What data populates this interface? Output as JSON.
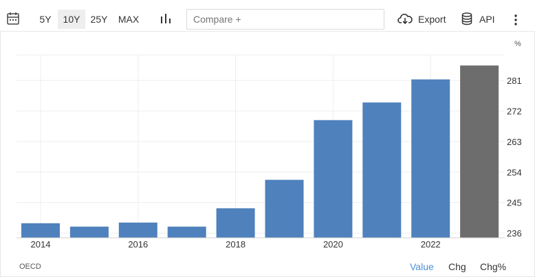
{
  "toolbar": {
    "ranges": [
      "5Y",
      "10Y",
      "25Y",
      "MAX"
    ],
    "active_range": "10Y",
    "compare_placeholder": "Compare +",
    "export_label": "Export",
    "api_label": "API"
  },
  "chart_data": {
    "type": "bar",
    "unit_label": "%",
    "x_tick_labels": [
      "2014",
      "2016",
      "2018",
      "2020",
      "2022"
    ],
    "categories": [
      "2014",
      "2015",
      "2016",
      "2017",
      "2018",
      "2019",
      "2020",
      "2021",
      "2022",
      "2023"
    ],
    "values": [
      238.9,
      237.9,
      239.1,
      237.9,
      243.3,
      251.7,
      269.3,
      274.5,
      281.3,
      285.4
    ],
    "ylim": [
      234.6,
      288.5
    ],
    "y_ticks": [
      236,
      245,
      254,
      263,
      272,
      281
    ],
    "grid": true,
    "colors": {
      "bar": "#4f81bd",
      "last_bar": "#6d6d6d",
      "grid": "#ededed"
    }
  },
  "footer": {
    "source": "OECD",
    "tabs": [
      "Value",
      "Chg",
      "Chg%"
    ],
    "active_tab": "Value"
  }
}
